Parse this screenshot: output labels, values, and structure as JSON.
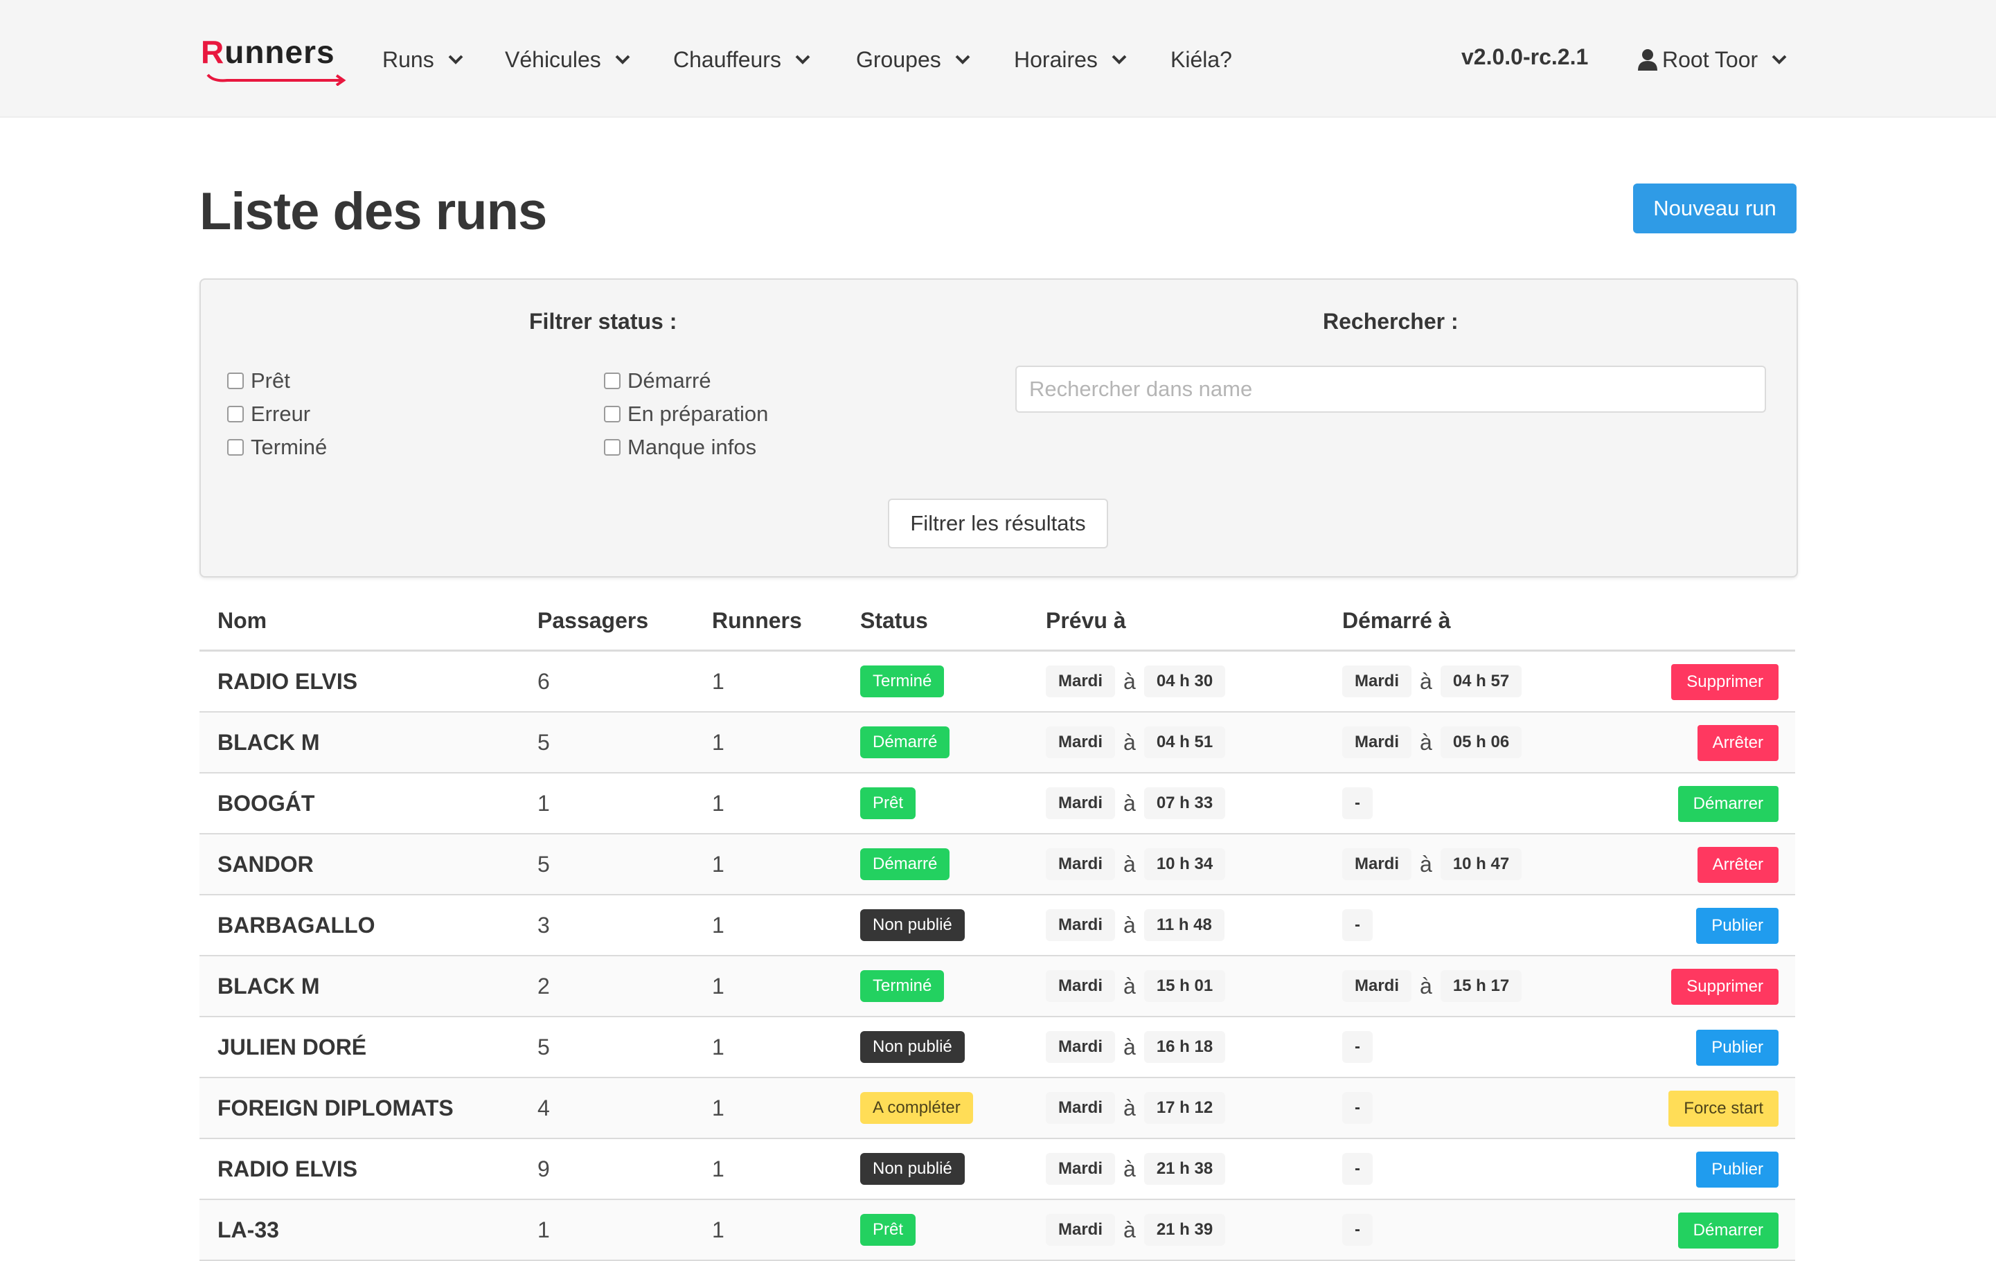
{
  "nav": {
    "brand": "Runners",
    "items": [
      {
        "label": "Runs"
      },
      {
        "label": "Véhicules"
      },
      {
        "label": "Chauffeurs"
      },
      {
        "label": "Groupes"
      },
      {
        "label": "Horaires"
      },
      {
        "label": "Kiéla?"
      }
    ],
    "version": "v2.0.0-rc.2.1",
    "user": "Root Toor"
  },
  "page": {
    "title": "Liste des runs",
    "new_button": "Nouveau run"
  },
  "filters": {
    "status_title": "Filtrer status :",
    "search_title": "Rechercher :",
    "search_placeholder": "Rechercher dans name",
    "search_value": "",
    "checkboxes": [
      {
        "label": "Prêt",
        "checked": false
      },
      {
        "label": "Erreur",
        "checked": false
      },
      {
        "label": "Terminé",
        "checked": false
      },
      {
        "label": "Démarré",
        "checked": false
      },
      {
        "label": "En préparation",
        "checked": false
      },
      {
        "label": "Manque infos",
        "checked": false
      }
    ],
    "submit_label": "Filtrer les résultats"
  },
  "table": {
    "headers": [
      "Nom",
      "Passagers",
      "Runners",
      "Status",
      "Prévu à",
      "Démarré à"
    ],
    "at_word": "à",
    "rows": [
      {
        "name": "RADIO ELVIS",
        "passengers": "6",
        "runners": "1",
        "status": "Terminé",
        "planned_day": "Mardi",
        "planned_time": "04 h 30",
        "started_day": "Mardi",
        "started_time": "04 h 57",
        "action": "Supprimer"
      },
      {
        "name": "BLACK M",
        "passengers": "5",
        "runners": "1",
        "status": "Démarré",
        "planned_day": "Mardi",
        "planned_time": "04 h 51",
        "started_day": "Mardi",
        "started_time": "05 h 06",
        "action": "Arrêter"
      },
      {
        "name": "BOOGÁT",
        "passengers": "1",
        "runners": "1",
        "status": "Prêt",
        "planned_day": "Mardi",
        "planned_time": "07 h 33",
        "started_dash": "-",
        "action": "Démarrer"
      },
      {
        "name": "SANDOR",
        "passengers": "5",
        "runners": "1",
        "status": "Démarré",
        "planned_day": "Mardi",
        "planned_time": "10 h 34",
        "started_day": "Mardi",
        "started_time": "10 h 47",
        "action": "Arrêter"
      },
      {
        "name": "BARBAGALLO",
        "passengers": "3",
        "runners": "1",
        "status": "Non publié",
        "planned_day": "Mardi",
        "planned_time": "11 h 48",
        "started_dash": "-",
        "action": "Publier"
      },
      {
        "name": "BLACK M",
        "passengers": "2",
        "runners": "1",
        "status": "Terminé",
        "planned_day": "Mardi",
        "planned_time": "15 h 01",
        "started_day": "Mardi",
        "started_time": "15 h 17",
        "action": "Supprimer"
      },
      {
        "name": "JULIEN DORÉ",
        "passengers": "5",
        "runners": "1",
        "status": "Non publié",
        "planned_day": "Mardi",
        "planned_time": "16 h 18",
        "started_dash": "-",
        "action": "Publier"
      },
      {
        "name": "FOREIGN DIPLOMATS",
        "passengers": "4",
        "runners": "1",
        "status": "A compléter",
        "planned_day": "Mardi",
        "planned_time": "17 h 12",
        "started_dash": "-",
        "action": "Force start"
      },
      {
        "name": "RADIO ELVIS",
        "passengers": "9",
        "runners": "1",
        "status": "Non publié",
        "planned_day": "Mardi",
        "planned_time": "21 h 38",
        "started_dash": "-",
        "action": "Publier"
      },
      {
        "name": "LA-33",
        "passengers": "1",
        "runners": "1",
        "status": "Prêt",
        "planned_day": "Mardi",
        "planned_time": "21 h 39",
        "started_dash": "-",
        "action": "Démarrer"
      }
    ]
  },
  "colors": {
    "brand_red": "#e8173e",
    "primary": "#2f9be6",
    "success": "#23d160",
    "danger": "#ff3860",
    "info": "#209cee",
    "warning": "#ffdd57",
    "dark": "#363636"
  }
}
